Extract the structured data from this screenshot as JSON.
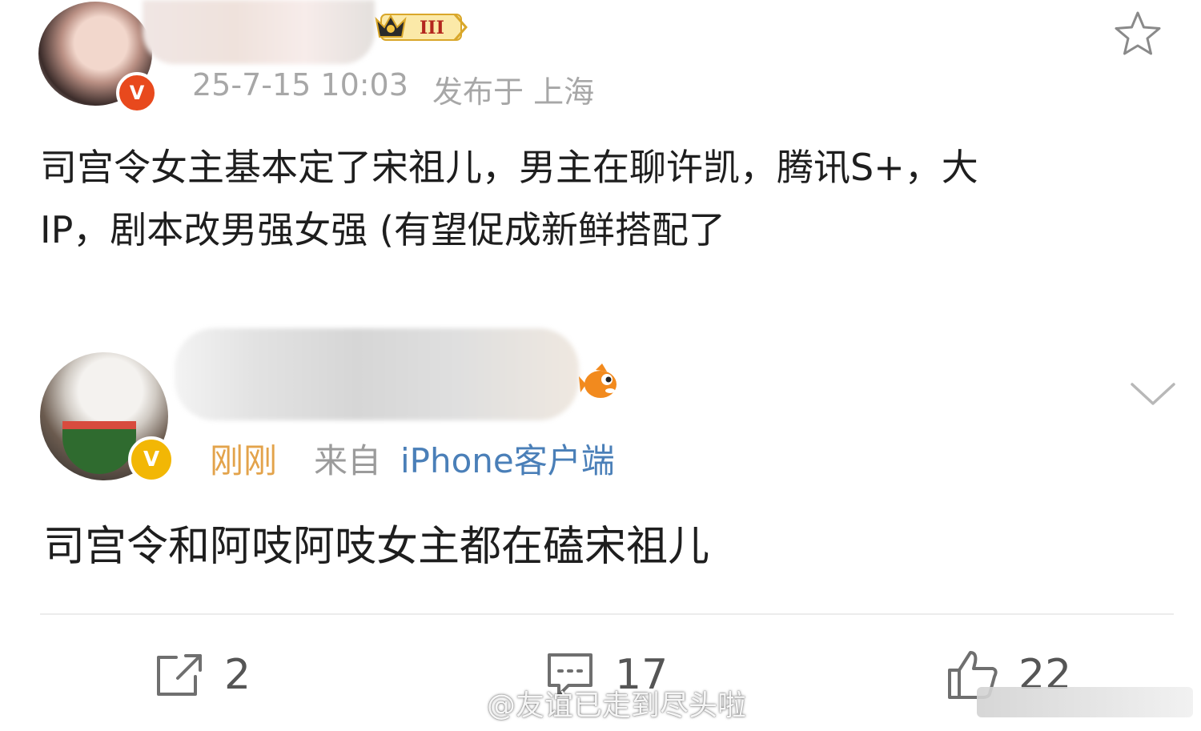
{
  "post": {
    "time": "25-7-15 10:03",
    "source": "发布于 上海",
    "content_line1": "司宫令女主基本定了宋祖儿，男主在聊许凯，腾讯S+，大",
    "content_line2": "IP，剧本改男强女强 (有望促成新鲜搭配了",
    "badge_level": "III"
  },
  "comment": {
    "time": "刚刚",
    "source_prefix": "来自",
    "source_app": "iPhone客户端",
    "text": "司宫令和阿吱阿吱女主都在磕宋祖儿"
  },
  "actions": {
    "repost_count": "2",
    "comment_count": "17",
    "like_count": "22"
  },
  "watermark": {
    "text": "@友谊已走到尽头啦"
  },
  "icons": {
    "favorite": "star-icon",
    "more": "chevron-down-icon",
    "repost": "share-icon",
    "comment": "comment-icon",
    "like": "thumbs-up-icon",
    "verified": "verified-badge-icon"
  },
  "colors": {
    "time_highlight": "#e3a34b",
    "source_app": "#4a7fb8",
    "verified_orange": "#e8491d",
    "verified_gold": "#f2b705"
  }
}
